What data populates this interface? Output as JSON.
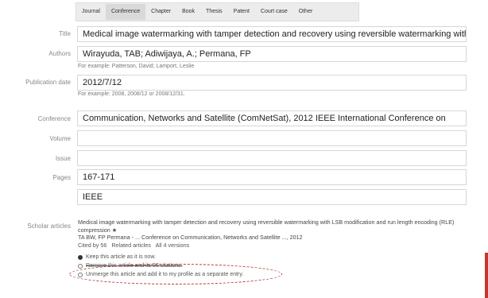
{
  "tabs": [
    "Journal",
    "Conference",
    "Chapter",
    "Book",
    "Thesis",
    "Patent",
    "Court case",
    "Other"
  ],
  "active_tab": "Conference",
  "form": {
    "title": {
      "label": "Title",
      "value": "Medical image watermarking with tamper detection and recovery using reversible watermarking with LSB modif"
    },
    "authors": {
      "label": "Authors",
      "value": "Wirayuda, TAB; Adiwijaya, A.; Permana, FP",
      "hint": "For example: Patterson, David; Lamport, Leslie"
    },
    "pubdate": {
      "label": "Publication date",
      "value": "2012/7/12",
      "hint": "For example: 2008, 2008/12 or 2008/12/31."
    },
    "conference": {
      "label": "Conference",
      "value": "Communication, Networks and Satellite (ComNetSat), 2012 IEEE International Conference on"
    },
    "volume": {
      "label": "Volume",
      "value": ""
    },
    "issue": {
      "label": "Issue",
      "value": ""
    },
    "pages": {
      "label": "Pages",
      "value": "167-171"
    },
    "publisher": {
      "value": "IEEE"
    }
  },
  "scholar": {
    "label": "Scholar articles",
    "article": "Medical image watermarking with tamper detection and recovery using reversible watermarking with LSB modification and run length encoding (RLE) compression",
    "star": "★",
    "authors_line": "TA BW, FP Permana - ... Conference on Communication, Networks and Satellite ..., 2012",
    "cited_by": "Cited by 56",
    "related": "Related articles",
    "versions": "All 4 versions",
    "options": [
      "Keep this article as it is now.",
      "Remove this article and its 56 citations.",
      "Unmerge this article and add it to my profile as a separate entry."
    ]
  }
}
